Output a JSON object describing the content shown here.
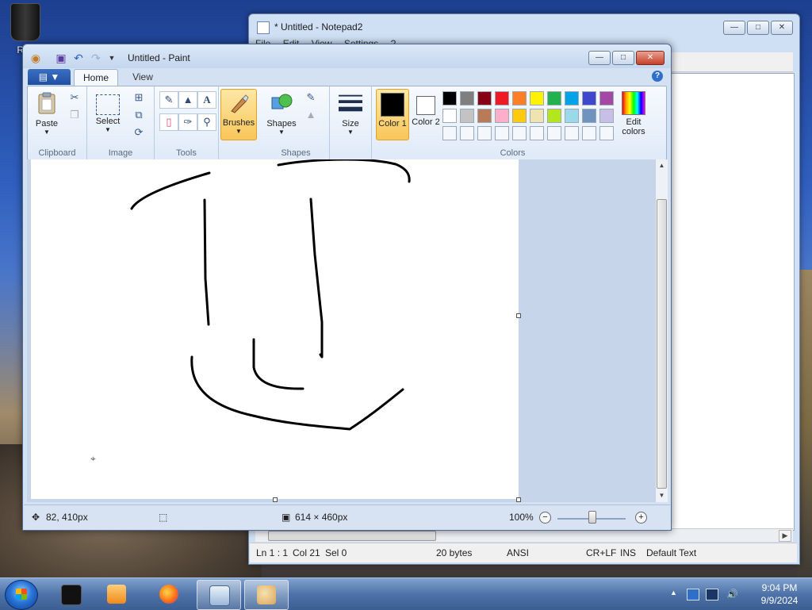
{
  "desktop": {
    "recycle_label": "Rec"
  },
  "notepad": {
    "title": "* Untitled - Notepad2",
    "menu": [
      "File",
      "Edit",
      "View",
      "Settings",
      "?"
    ],
    "status": {
      "position": "Ln 1 : 1",
      "col": "Col 21",
      "sel": "Sel 0",
      "size": "20 bytes",
      "encoding": "ANSI",
      "eol": "CR+LF",
      "ins": "INS",
      "scheme": "Default Text"
    }
  },
  "paint": {
    "title": "Untitled - Paint",
    "tabs": {
      "home": "Home",
      "view": "View"
    },
    "ribbon": {
      "paste": "Paste",
      "select": "Select",
      "brushes": "Brushes",
      "shapes": "Shapes",
      "size": "Size",
      "color1": "Color 1",
      "color2": "Color 2",
      "edit_colors": "Edit colors",
      "groups": {
        "clipboard": "Clipboard",
        "image": "Image",
        "tools": "Tools",
        "shapes": "Shapes",
        "colors": "Colors"
      }
    },
    "palette_row1": [
      "#000000",
      "#7f7f7f",
      "#880015",
      "#ed1c24",
      "#ff7f27",
      "#fff200",
      "#22b14c",
      "#00a2e8",
      "#3f48cc",
      "#a349a4"
    ],
    "palette_row2": [
      "#ffffff",
      "#c3c3c3",
      "#b97a57",
      "#ffaec9",
      "#ffc90e",
      "#efe4b0",
      "#b5e61d",
      "#99d9ea",
      "#7092be",
      "#c8bfe7"
    ],
    "active_color1": "#000000",
    "active_color2": "#ffffff",
    "status": {
      "cursor_pos": "82, 410px",
      "canvas_size": "614 × 460px",
      "zoom": "100%"
    }
  },
  "taskbar": {
    "time": "9:04 PM",
    "date": "9/9/2024"
  }
}
